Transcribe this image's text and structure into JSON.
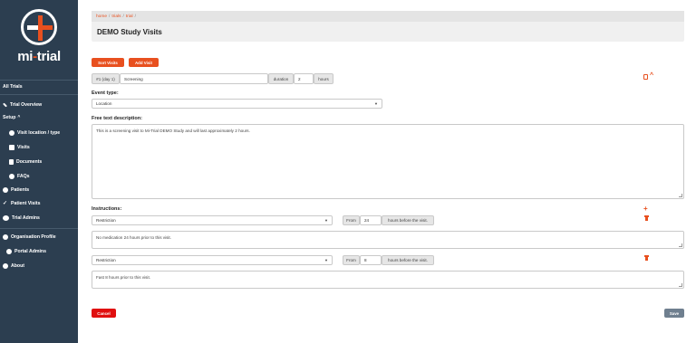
{
  "app": {
    "logo_text_mi": "mi",
    "logo_text_dash": "-",
    "logo_text_trial": "trial"
  },
  "sidebar": {
    "all_trials": "All Trials",
    "trial_overview": "Trial Overview",
    "setup": "Setup",
    "visit_location": "Visit location / type",
    "visits": "Visits",
    "documents": "Documents",
    "faqs": "FAQs",
    "patients": "Patients",
    "patient_visits": "Patient Visits",
    "trial_admins": "Trial Admins",
    "organisation_profile": "Organisation Profile",
    "portal_admins": "Portal Admins",
    "about": "About"
  },
  "breadcrumb": {
    "home": "home",
    "trials": "trials",
    "trial": "trial",
    "sep": "/"
  },
  "page": {
    "title": "DEMO Study Visits"
  },
  "toolbar": {
    "sort": "Sort Visits",
    "add": "Add Visit"
  },
  "visit": {
    "number": "#1 (day 1)",
    "name": "Screening",
    "duration_label": "duration",
    "duration_value": "2",
    "hours_label": "hours",
    "event_type_label": "Event type:",
    "event_type": "Location",
    "desc_label": "Free text description:",
    "description": "This is a screening visit to Mi-Trial DEMO Study and will last approximately 2 hours.",
    "instructions_label": "Instructions:"
  },
  "instructions": [
    {
      "type": "Restriction",
      "from": "From",
      "hours": "24",
      "suffix": "hours before the visit.",
      "text": "No medication 24 hours prior to this visit."
    },
    {
      "type": "Restriction",
      "from": "From",
      "hours": "8",
      "suffix": "hours before the visit.",
      "text": "Fast 8 hours prior to this visit."
    }
  ],
  "footer": {
    "cancel": "Cancel",
    "save": "Save"
  },
  "colors": {
    "accent": "#e8501f",
    "sidebar": "#2c3e50",
    "danger": "#e01010"
  }
}
